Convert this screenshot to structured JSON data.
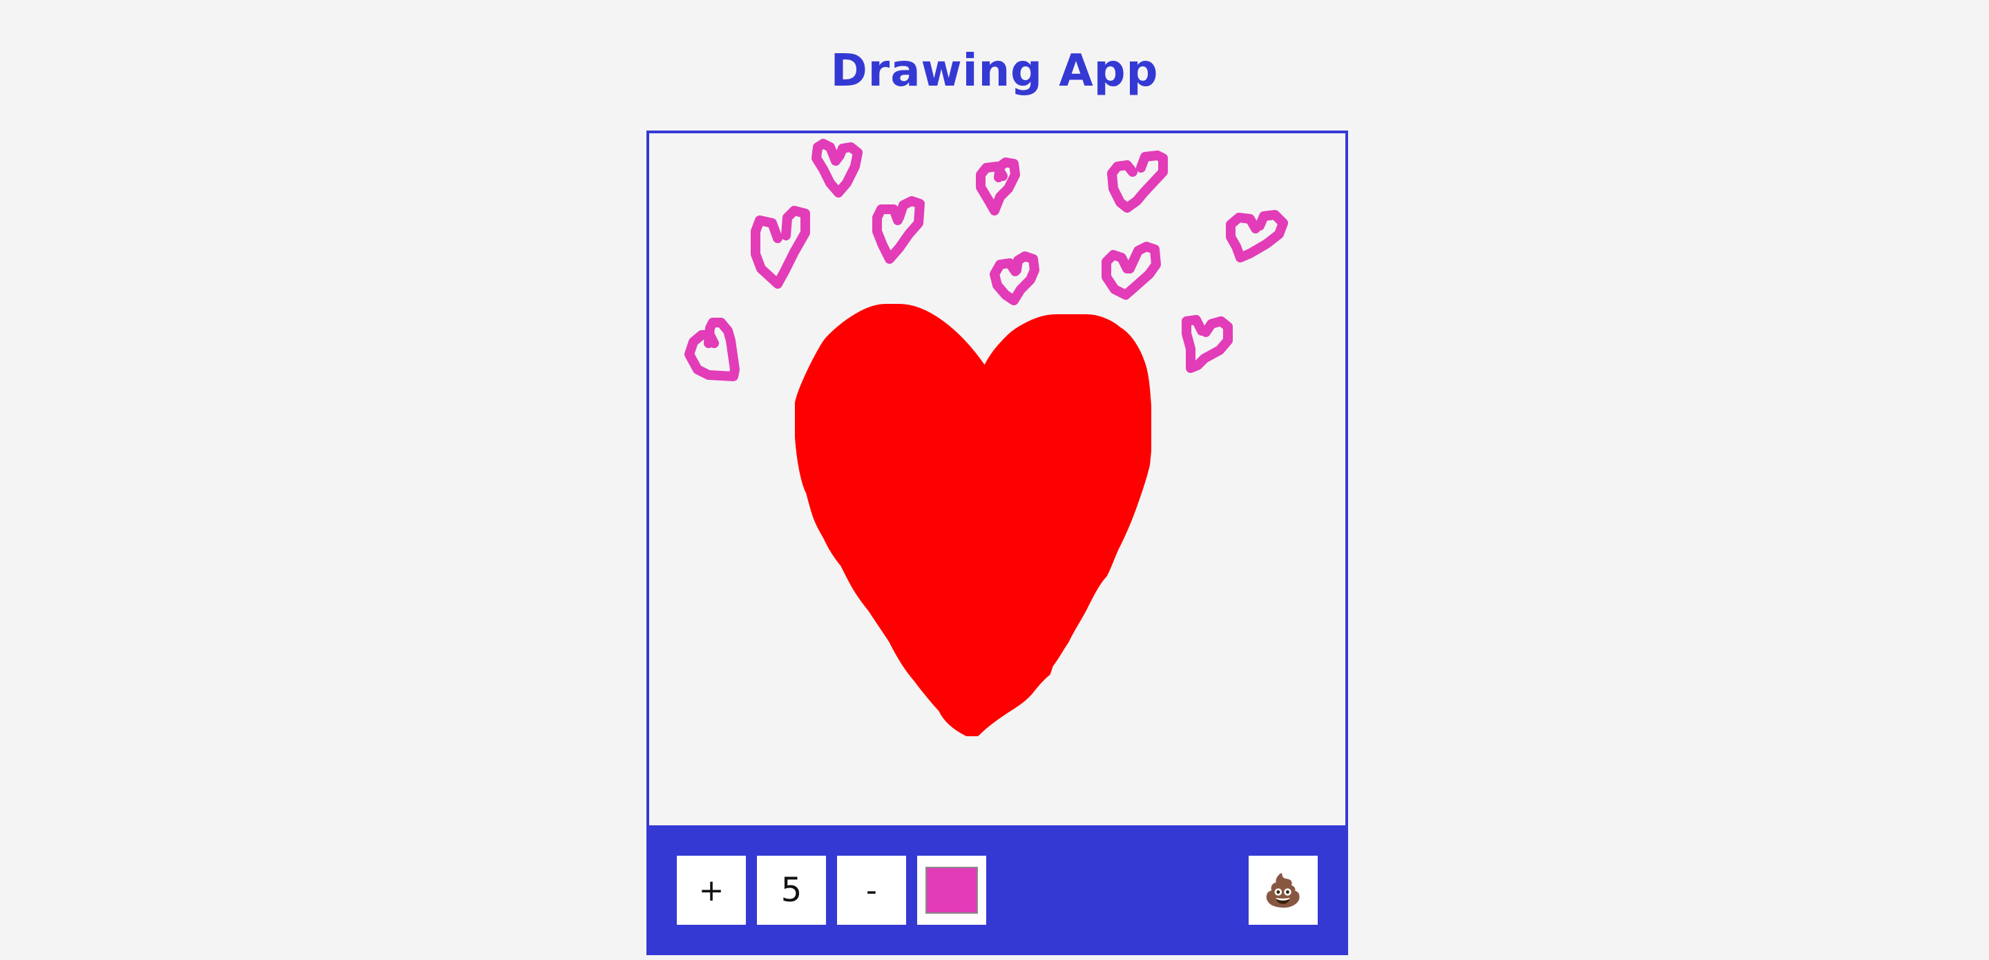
{
  "app": {
    "title": "Drawing App"
  },
  "colors": {
    "accent": "#3539d4",
    "background": "#f4f4f4",
    "current_brush": "#e23cb8",
    "big_heart": "#ff0000"
  },
  "toolbox": {
    "increase_label": "+",
    "brush_size": "5",
    "decrease_label": "-",
    "color_value": "#e23cb8",
    "clear_label": "💩",
    "clear_icon": "poo-icon"
  }
}
